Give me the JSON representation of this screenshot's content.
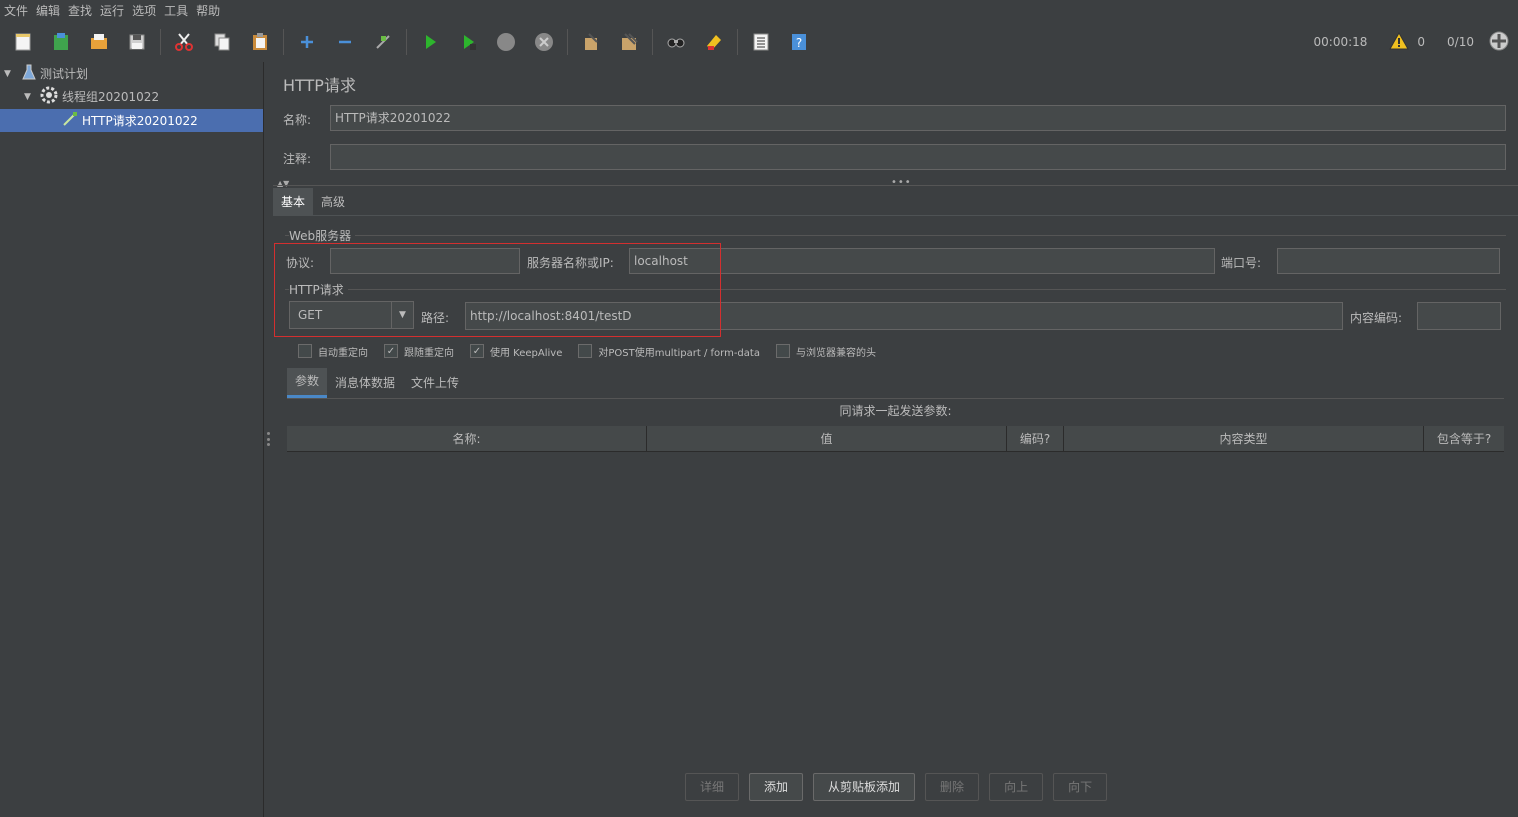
{
  "menu": [
    "文件",
    "编辑",
    "查找",
    "运行",
    "选项",
    "工具",
    "帮助"
  ],
  "toolbar": {
    "timer": "00:00:18",
    "warn_count": "0",
    "threads": "0/10",
    "icons": [
      "new-icon",
      "templates-icon",
      "open-icon",
      "save-icon",
      "cut-icon",
      "copy-icon",
      "paste-icon",
      "expand-icon",
      "collapse-icon",
      "toggle-icon",
      "start-icon",
      "start-no-pause-icon",
      "stop-icon",
      "shutdown-icon",
      "clear-icon",
      "clear-all-icon",
      "search-icon",
      "reset-search-icon",
      "function-helper-icon",
      "help-icon"
    ]
  },
  "tree": {
    "plan": "测试计划",
    "thread_group": "线程组20201022",
    "http_request": "HTTP请求20201022"
  },
  "panel": {
    "title": "HTTP请求",
    "name_label": "名称:",
    "name_value": "HTTP请求20201022",
    "comment_label": "注释:",
    "comment_value": ""
  },
  "tabs": [
    "基本",
    "高级"
  ],
  "web_server": {
    "group_title": "Web服务器",
    "protocol_label": "协议:",
    "protocol_value": "",
    "server_label": "服务器名称或IP:",
    "server_value": "localhost",
    "port_label": "端口号:",
    "port_value": ""
  },
  "http_request": {
    "group_title": "HTTP请求",
    "method": "GET",
    "path_label": "路径:",
    "path_value": "http://localhost:8401/testD",
    "encoding_label": "内容编码:",
    "encoding_value": ""
  },
  "checkboxes": [
    {
      "label": "自动重定向",
      "checked": false
    },
    {
      "label": "跟随重定向",
      "checked": true
    },
    {
      "label": "使用 KeepAlive",
      "checked": true
    },
    {
      "label": "对POST使用multipart / form-data",
      "checked": false
    },
    {
      "label": "与浏览器兼容的头",
      "checked": false
    }
  ],
  "subtabs": [
    "参数",
    "消息体数据",
    "文件上传"
  ],
  "params_table": {
    "caption": "同请求一起发送参数:",
    "columns": [
      "名称:",
      "值",
      "编码?",
      "内容类型",
      "包含等于?"
    ]
  },
  "buttons": {
    "detail": "详细",
    "add": "添加",
    "add_clipboard": "从剪贴板添加",
    "delete": "删除",
    "up": "向上",
    "down": "向下"
  },
  "colors": {
    "background": "#3c3f41",
    "selection": "#4b6eaf",
    "highlight_border": "#d32f2f"
  }
}
